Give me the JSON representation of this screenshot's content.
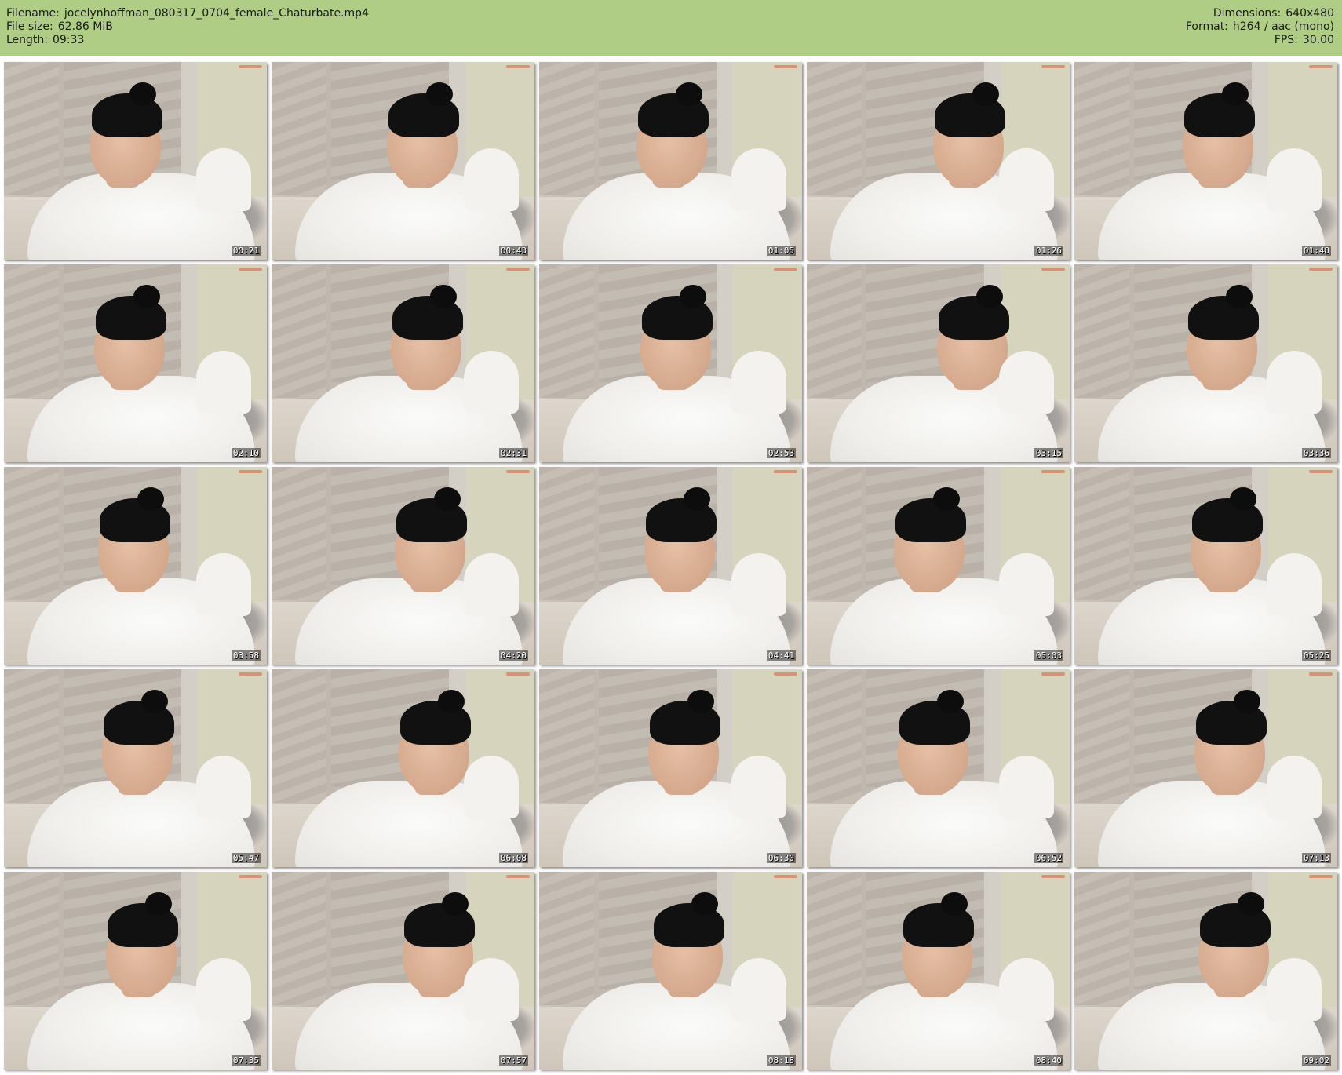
{
  "header": {
    "filename_label": "Filename:",
    "filename": "jocelynhoffman_080317_0704_female_Chaturbate.mp4",
    "filesize_label": "File size:",
    "filesize": "62.86 MiB",
    "length_label": "Length:",
    "length": "09:33",
    "dimensions_label": "Dimensions:",
    "dimensions": "640x480",
    "format_label": "Format:",
    "format": "h264 / aac (mono)",
    "fps_label": "FPS:",
    "fps": "30.00"
  },
  "colors": {
    "header_bg": "#afcd84",
    "page_bg": "#ffffff"
  },
  "thumbnails": [
    {
      "timestamp": "00:21"
    },
    {
      "timestamp": "00:43"
    },
    {
      "timestamp": "01:05"
    },
    {
      "timestamp": "01:26"
    },
    {
      "timestamp": "01:48"
    },
    {
      "timestamp": "02:10"
    },
    {
      "timestamp": "02:31"
    },
    {
      "timestamp": "02:53"
    },
    {
      "timestamp": "03:15"
    },
    {
      "timestamp": "03:36"
    },
    {
      "timestamp": "03:58"
    },
    {
      "timestamp": "04:20"
    },
    {
      "timestamp": "04:41"
    },
    {
      "timestamp": "05:03"
    },
    {
      "timestamp": "05:25"
    },
    {
      "timestamp": "05:47"
    },
    {
      "timestamp": "06:08"
    },
    {
      "timestamp": "06:30"
    },
    {
      "timestamp": "06:52"
    },
    {
      "timestamp": "07:13"
    },
    {
      "timestamp": "07:35"
    },
    {
      "timestamp": "07:57"
    },
    {
      "timestamp": "08:18"
    },
    {
      "timestamp": "08:40"
    },
    {
      "timestamp": "09:02"
    }
  ]
}
